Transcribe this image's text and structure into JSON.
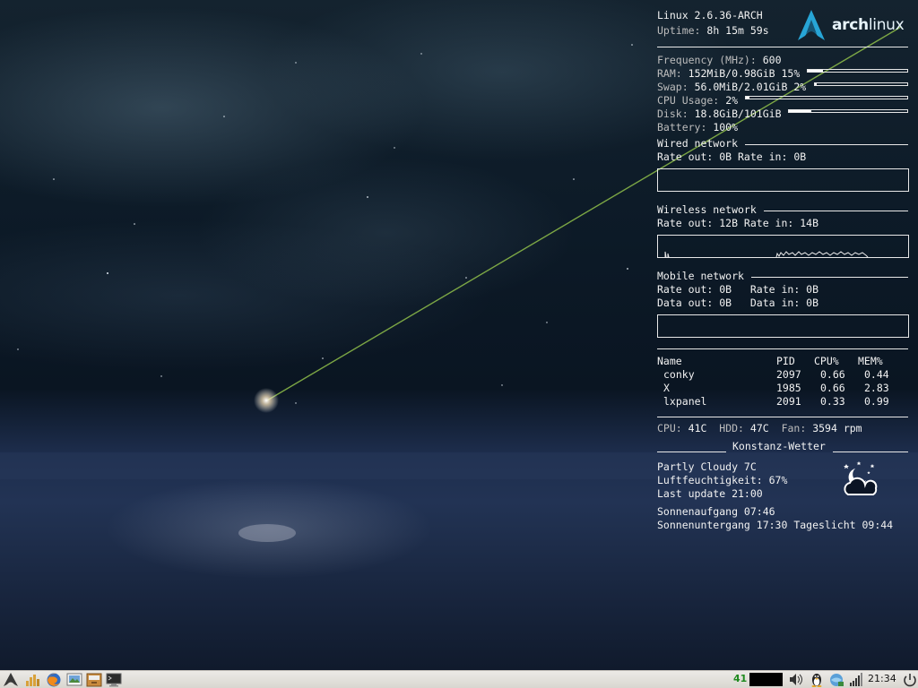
{
  "system": {
    "kernel": "Linux 2.6.36-ARCH",
    "uptime_label": "Uptime:",
    "uptime": "8h 15m 59s",
    "logo_text_bold": "arch",
    "logo_text_light": "linux"
  },
  "stats": {
    "frequency_label": "Frequency (MHz):",
    "frequency": "600",
    "ram_label": "RAM:",
    "ram": "152MiB/0.98GiB 15%",
    "ram_percent": 15,
    "swap_label": "Swap:",
    "swap": "56.0MiB/2.01GiB 2%",
    "swap_percent": 2,
    "cpu_label": "CPU Usage:",
    "cpu": "2%",
    "cpu_percent": 2,
    "disk_label": "Disk:",
    "disk": "18.8GiB/101GiB",
    "disk_percent": 19,
    "battery_label": "Battery:",
    "battery": "100%"
  },
  "wired": {
    "title": "Wired network",
    "rates": "Rate out: 0B Rate in: 0B"
  },
  "wireless": {
    "title": "Wireless network",
    "rates": "Rate out: 12B Rate in: 14B"
  },
  "mobile": {
    "title": "Mobile network",
    "rates": "Rate out: 0B   Rate in: 0B",
    "data": "Data out: 0B   Data in: 0B"
  },
  "processes": {
    "headers": [
      "Name",
      "PID",
      "CPU%",
      "MEM%"
    ],
    "rows": [
      {
        "name": "conky",
        "pid": "2097",
        "cpu": "0.66",
        "mem": "0.44"
      },
      {
        "name": "X",
        "pid": "1985",
        "cpu": "0.66",
        "mem": "2.83"
      },
      {
        "name": "lxpanel",
        "pid": "2091",
        "cpu": "0.33",
        "mem": "0.99"
      }
    ]
  },
  "temps": {
    "cpu_label": "CPU:",
    "cpu": "41C",
    "hdd_label": "HDD:",
    "hdd": "47C",
    "fan_label": "Fan:",
    "fan": "3594 rpm"
  },
  "weather": {
    "title": "Konstanz-Wetter",
    "condition": "Partly Cloudy 7C",
    "humidity": "Luftfeuchtigkeit: 67%",
    "last_update": "Last update 21:00",
    "sunrise": "Sonnenaufgang 07:46",
    "sunset": "Sonnenuntergang 17:30 Tageslicht 09:44",
    "icon": "partly-cloudy-night-icon"
  },
  "taskbar": {
    "launchers": [
      "menu-icon",
      "files-icon",
      "firefox-icon",
      "image-viewer-icon",
      "archive-icon",
      "terminal-icon"
    ],
    "workspace": "41",
    "clock": "21:34",
    "tray_icons": [
      "volume-icon",
      "tux-icon",
      "network-manager-icon",
      "signal-icon",
      "logout-icon"
    ]
  }
}
